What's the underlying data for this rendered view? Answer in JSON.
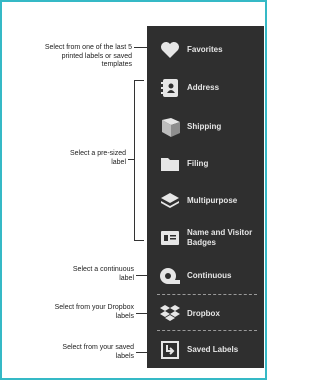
{
  "colors": {
    "frame_border": "#35b9c6",
    "panel_bg": "#2f2f2f",
    "label_text": "#e6e6e6",
    "annotation_text": "#222222"
  },
  "menu": {
    "items": [
      {
        "label": "Favorites",
        "icon": "heart-icon"
      },
      {
        "label": "Address",
        "icon": "address-book-icon"
      },
      {
        "label": "Shipping",
        "icon": "box-icon"
      },
      {
        "label": "Filing",
        "icon": "folder-icon"
      },
      {
        "label": "Multipurpose",
        "icon": "layers-icon"
      },
      {
        "label": "Name and Visitor Badges",
        "icon": "badge-icon"
      },
      {
        "label": "Continuous",
        "icon": "tape-roll-icon"
      },
      {
        "label": "Dropbox",
        "icon": "dropbox-icon"
      },
      {
        "label": "Saved Labels",
        "icon": "saved-labels-icon"
      }
    ]
  },
  "annotations": {
    "favorites": "Select from one of the last 5 printed labels or saved templates",
    "presized": "Select a pre-sized label",
    "continuous": "Select a continuous label",
    "dropbox": "Select from your Dropbox labels",
    "saved": "Select from your saved labels"
  }
}
